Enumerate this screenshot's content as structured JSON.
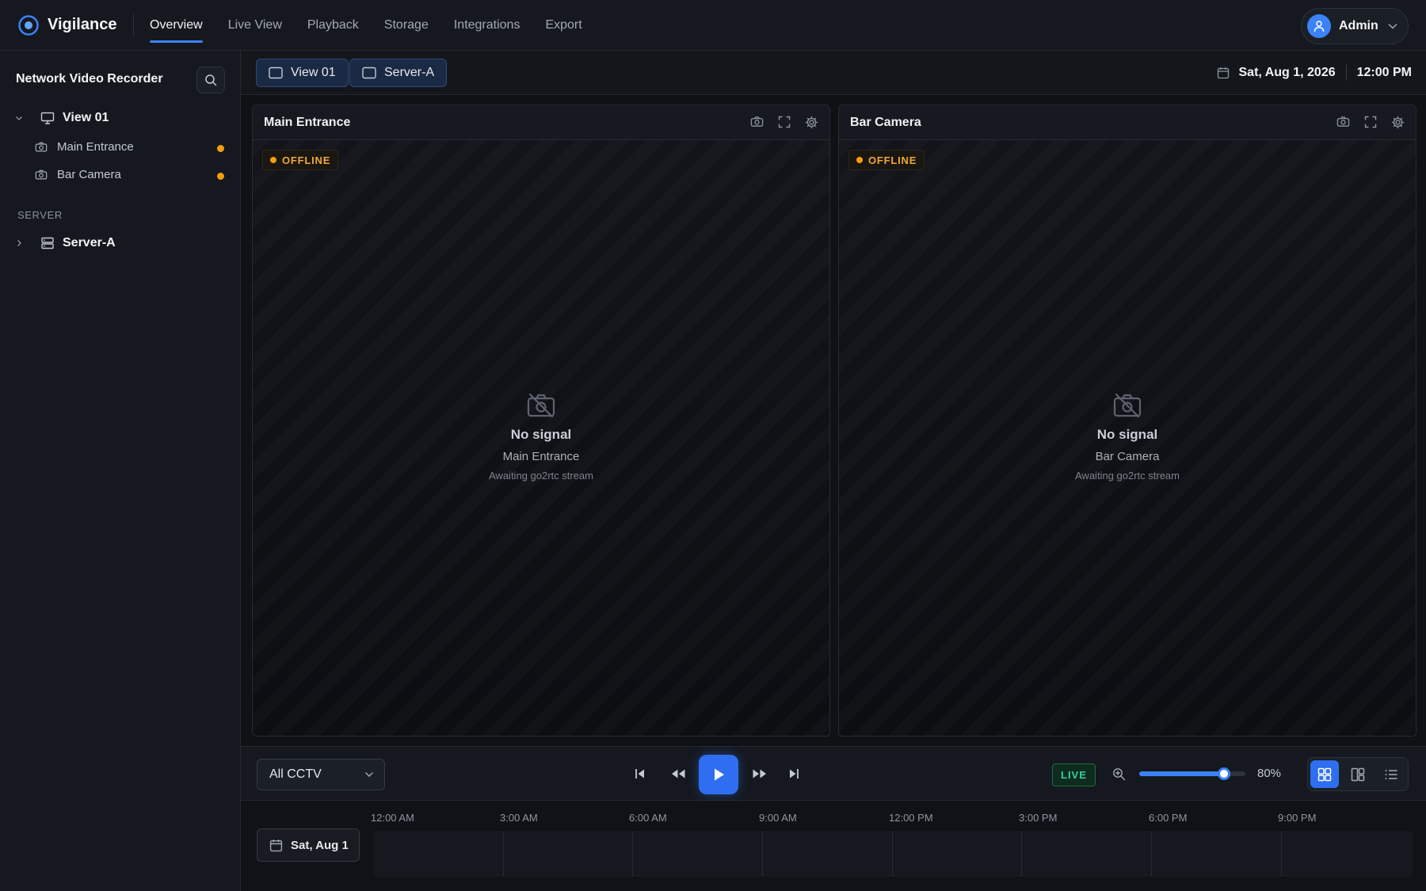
{
  "app": {
    "name": "Vigilance",
    "colors": {
      "accent": "#3b82f6",
      "offline": "#f59e0b",
      "live": "#34d399",
      "background": "#0f1115"
    }
  },
  "nav": {
    "items": [
      {
        "label": "Overview",
        "active": true
      },
      {
        "label": "Live View",
        "active": false
      },
      {
        "label": "Playback",
        "active": false
      },
      {
        "label": "Storage",
        "active": false
      },
      {
        "label": "Integrations",
        "active": false
      },
      {
        "label": "Export",
        "active": false
      }
    ]
  },
  "user": {
    "name": "Admin",
    "icon": "user-icon"
  },
  "sidebar": {
    "title": "Network Video Recorder",
    "search_icon": "search-icon",
    "view": {
      "label": "View 01",
      "icon": "monitor-icon",
      "expanded": true
    },
    "cameras": [
      {
        "label": "Main Entrance",
        "icon": "camera-icon",
        "status": "offline"
      },
      {
        "label": "Bar Camera",
        "icon": "camera-icon",
        "status": "offline"
      }
    ],
    "section_label": "SERVER",
    "server": {
      "label": "Server-A",
      "icon": "server-icon",
      "expanded": false
    }
  },
  "viewbar": {
    "tabs": [
      {
        "label": "View 01",
        "icon": "square-icon"
      },
      {
        "label": "Server-A",
        "icon": "square-icon"
      }
    ],
    "date": "Sat, Aug 1, 2026",
    "time": "12:00 PM"
  },
  "tiles": [
    {
      "title": "Main Entrance",
      "status_label": "OFFLINE",
      "nosignal_title": "No signal",
      "camera_name": "Main Entrance",
      "subtitle": "Awaiting go2rtc stream"
    },
    {
      "title": "Bar Camera",
      "status_label": "OFFLINE",
      "nosignal_title": "No signal",
      "camera_name": "Bar Camera",
      "subtitle": "Awaiting go2rtc stream"
    }
  ],
  "playback": {
    "filter_value": "All CCTV",
    "live_label": "LIVE",
    "zoom_percent": 80,
    "zoom_label": "80%",
    "layout_options": [
      "grid-icon",
      "split-icon",
      "list-icon"
    ],
    "active_layout": "grid-icon"
  },
  "timeline": {
    "date_label": "Sat, Aug 1",
    "ticks": [
      "12:00 AM",
      "3:00 AM",
      "6:00 AM",
      "9:00 AM",
      "12:00 PM",
      "3:00 PM",
      "6:00 PM",
      "9:00 PM"
    ]
  }
}
